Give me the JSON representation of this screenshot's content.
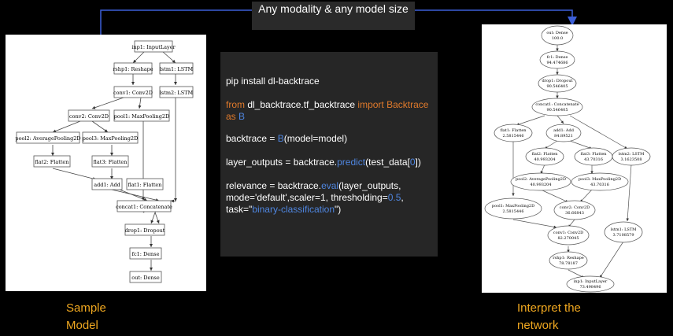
{
  "banner": {
    "text": "Any modality & any model size"
  },
  "captions": {
    "left": "Sample Model",
    "right": "Interpret the network"
  },
  "code": {
    "line1": "pip install dl-backtrace",
    "line2": {
      "from": "from",
      "module": " dl_backtrace.tf_backtrace ",
      "import": "import",
      "cls": " Backtrace",
      "as": "as",
      "alias": " B"
    },
    "line3": {
      "lhs": "backtrace = ",
      "fn": "B",
      "rhs": "(model=model)"
    },
    "line4": {
      "lhs": "layer_outputs = backtrace.",
      "fn": "predict",
      "a": "(test_data[",
      "idx": "0",
      "b": "])"
    },
    "line5": {
      "lhs": "relevance = backtrace.",
      "fn": "eval",
      "a": "(layer_outputs, mode='default',scaler=1, thresholding=",
      "num": "0.5",
      "b": ", task=\"",
      "str": "binary-classification",
      "c": "\")"
    }
  },
  "colors": {
    "arrow": "#3c5fd8",
    "keyword": "#e07a2b",
    "function": "#4f86e0",
    "caption": "#f0a820"
  },
  "left_graph": {
    "nodes": [
      "inp1: InputLayer",
      "rshp1: Reshape",
      "lstm1: LSTM",
      "conv1: Conv2D",
      "lstm2: LSTM",
      "conv2: Conv2D",
      "pool1: MaxPooling2D",
      "pool2: AveragePooling2D",
      "pool3: MaxPooling2D",
      "flat2: Flatten",
      "flat3: Flatten",
      "add1: Add",
      "flat1: Flatten",
      "concat1: Concatenate",
      "drop1: Dropout",
      "fc1: Dense",
      "out: Dense"
    ]
  },
  "right_graph": {
    "nodes": [
      {
        "name": "out: Dense",
        "value": "100.0"
      },
      {
        "name": "fc1: Dense",
        "value": "94.474686"
      },
      {
        "name": "drop1: Dropout",
        "value": "90.546405"
      },
      {
        "name": "concat1: Concatenate",
        "value": "90.546405"
      },
      {
        "name": "flat1: Flatten",
        "value": "2.5815446"
      },
      {
        "name": "add1: Add",
        "value": "84.89521"
      },
      {
        "name": "lstm2: LSTM",
        "value": "3.1623508"
      },
      {
        "name": "flat2: Flatten",
        "value": "40.993204"
      },
      {
        "name": "flat3: Flatten",
        "value": "43.70316"
      },
      {
        "name": "pool2: AveragePooling2D",
        "value": "40.993204"
      },
      {
        "name": "pool3: MaxPooling2D",
        "value": "43.70316"
      },
      {
        "name": "pool1: MaxPooling2D",
        "value": "2.5815446"
      },
      {
        "name": "conv2: Conv2D",
        "value": "36.66843"
      },
      {
        "name": "conv1: Conv2D",
        "value": "82.270045"
      },
      {
        "name": "lstm1: LSTM",
        "value": "3.7108579"
      },
      {
        "name": "rshp1: Reshape",
        "value": "78.78187"
      },
      {
        "name": "inp1: InputLayer",
        "value": "73.498496"
      }
    ]
  }
}
